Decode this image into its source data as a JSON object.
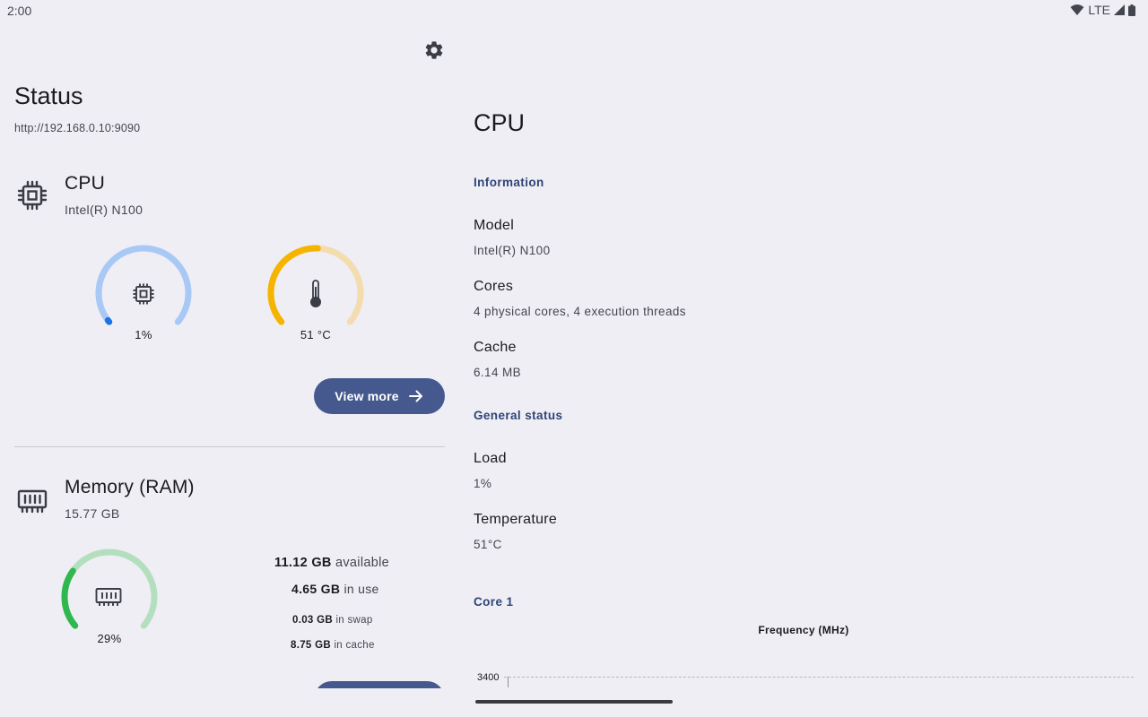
{
  "status_bar": {
    "time": "2:00",
    "network": "LTE"
  },
  "left": {
    "title": "Status",
    "url": "http://192.168.0.10:9090",
    "cpu": {
      "title": "CPU",
      "subtitle": "Intel(R) N100",
      "load_label": "1%",
      "load_value": 0.01,
      "temp_label": "51 °C",
      "temp_value": 0.51,
      "view_more": "View more"
    },
    "memory": {
      "title": "Memory (RAM)",
      "subtitle": "15.77 GB",
      "usage_label": "29%",
      "usage_value": 0.29,
      "available_value": "11.12 GB",
      "available_label": "available",
      "inuse_value": "4.65 GB",
      "inuse_label": "in use",
      "swap_value": "0.03 GB",
      "swap_label": "in swap",
      "cache_value": "8.75 GB",
      "cache_label": "in cache"
    }
  },
  "right": {
    "title": "CPU",
    "info_header": "Information",
    "model_label": "Model",
    "model_value": "Intel(R) N100",
    "cores_label": "Cores",
    "cores_value": "4 physical cores, 4 execution threads",
    "cache_label": "Cache",
    "cache_value": "6.14 MB",
    "general_header": "General status",
    "load_label": "Load",
    "load_value": "1%",
    "temp_label": "Temperature",
    "temp_value": "51°C",
    "core_header": "Core 1",
    "chart_title": "Frequency (MHz)",
    "tick_3400": "3400"
  },
  "colors": {
    "cpu_gauge_track": "#a8c8f5",
    "cpu_gauge_fill": "#1a73e8",
    "temp_gauge_track": "#f3dcae",
    "temp_gauge_fill": "#f4b400",
    "mem_gauge_track": "#b4dfbe",
    "mem_gauge_fill": "#2eb84d",
    "accent": "#45598f"
  },
  "icons": {
    "settings": "gear-icon",
    "cpu": "cpu-chip-icon",
    "memory": "memory-module-icon",
    "temperature": "thermometer-icon",
    "arrow": "arrow-right-icon"
  }
}
